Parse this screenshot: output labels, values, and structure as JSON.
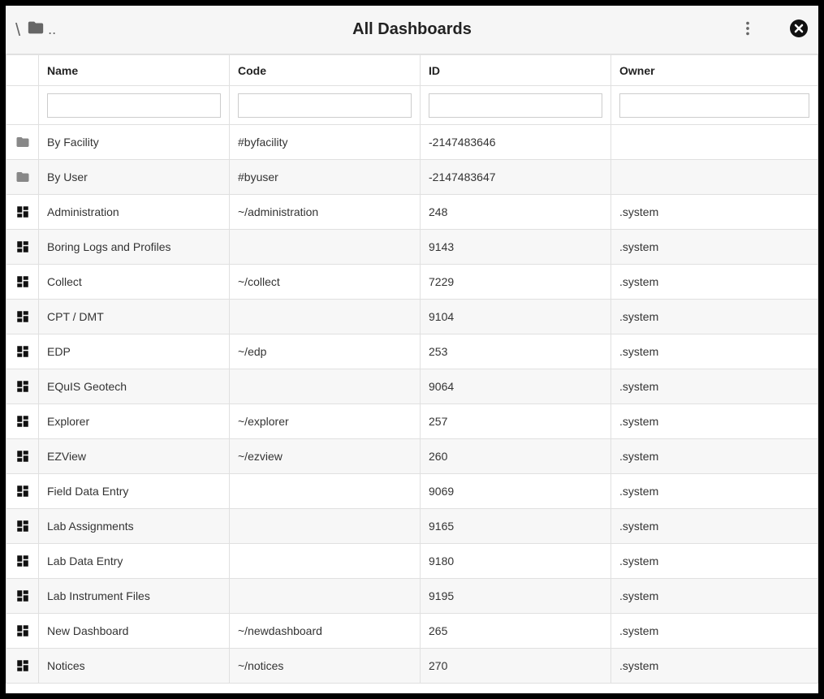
{
  "header": {
    "up_label": "..",
    "title": "All Dashboards"
  },
  "columns": {
    "name": "Name",
    "code": "Code",
    "id": "ID",
    "owner": "Owner"
  },
  "filters": {
    "name": "",
    "code": "",
    "id": "",
    "owner": ""
  },
  "rows": [
    {
      "icon": "folder",
      "name": "By Facility",
      "code": "#byfacility",
      "id": "-2147483646",
      "owner": ""
    },
    {
      "icon": "folder",
      "name": "By User",
      "code": "#byuser",
      "id": "-2147483647",
      "owner": ""
    },
    {
      "icon": "dashboard",
      "name": "Administration",
      "code": "~/administration",
      "id": "248",
      "owner": ".system"
    },
    {
      "icon": "dashboard",
      "name": "Boring Logs and Profiles",
      "code": "",
      "id": "9143",
      "owner": ".system"
    },
    {
      "icon": "dashboard",
      "name": "Collect",
      "code": "~/collect",
      "id": "7229",
      "owner": ".system"
    },
    {
      "icon": "dashboard",
      "name": "CPT / DMT",
      "code": "",
      "id": "9104",
      "owner": ".system"
    },
    {
      "icon": "dashboard",
      "name": "EDP",
      "code": "~/edp",
      "id": "253",
      "owner": ".system"
    },
    {
      "icon": "dashboard",
      "name": "EQuIS Geotech",
      "code": "",
      "id": "9064",
      "owner": ".system"
    },
    {
      "icon": "dashboard",
      "name": "Explorer",
      "code": "~/explorer",
      "id": "257",
      "owner": ".system"
    },
    {
      "icon": "dashboard",
      "name": "EZView",
      "code": "~/ezview",
      "id": "260",
      "owner": ".system"
    },
    {
      "icon": "dashboard",
      "name": "Field Data Entry",
      "code": "",
      "id": "9069",
      "owner": ".system"
    },
    {
      "icon": "dashboard",
      "name": "Lab Assignments",
      "code": "",
      "id": "9165",
      "owner": ".system"
    },
    {
      "icon": "dashboard",
      "name": "Lab Data Entry",
      "code": "",
      "id": "9180",
      "owner": ".system"
    },
    {
      "icon": "dashboard",
      "name": "Lab Instrument Files",
      "code": "",
      "id": "9195",
      "owner": ".system"
    },
    {
      "icon": "dashboard",
      "name": "New Dashboard",
      "code": "~/newdashboard",
      "id": "265",
      "owner": ".system"
    },
    {
      "icon": "dashboard",
      "name": "Notices",
      "code": "~/notices",
      "id": "270",
      "owner": ".system"
    }
  ]
}
